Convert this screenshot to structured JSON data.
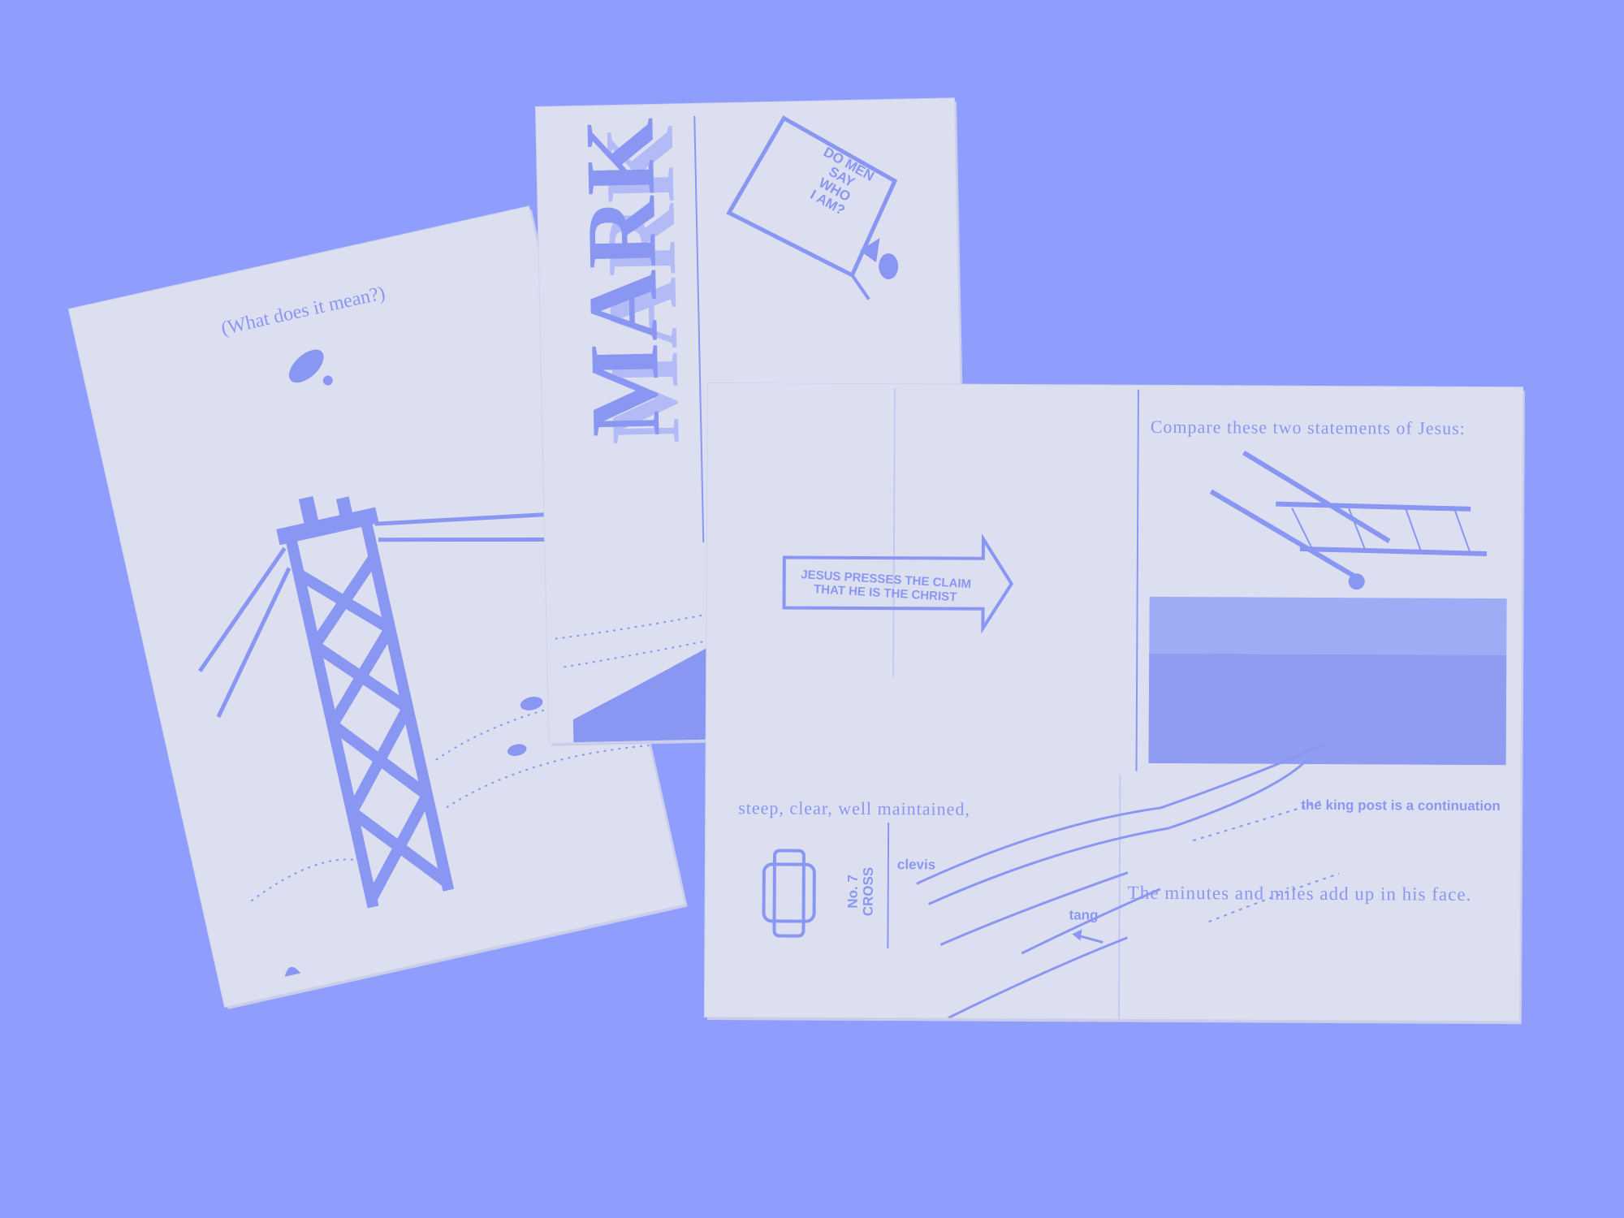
{
  "palette": {
    "background": "#8f9dfc",
    "paper": "#dcdff0",
    "ink": "#8a97f2"
  },
  "zine_left": {
    "caption": "(What does it mean?)"
  },
  "zine_mark": {
    "title": "MARK",
    "sign_text": [
      "DO MEN",
      "SAY",
      "WHO",
      "I AM?"
    ]
  },
  "spread": {
    "heading": "Compare these two statements of Jesus:",
    "arrow_sign": [
      "JESUS PRESSES THE CLAIM",
      "THAT HE IS THE CHRIST"
    ],
    "steep_line": "steep, clear, well maintained,",
    "king_post": "the king post is a continuation",
    "cross_label": [
      "No. 7",
      "CROSS"
    ],
    "clevis": "clevis",
    "tang": "tang",
    "minutes_line": "The minutes and miles add up in his face."
  }
}
